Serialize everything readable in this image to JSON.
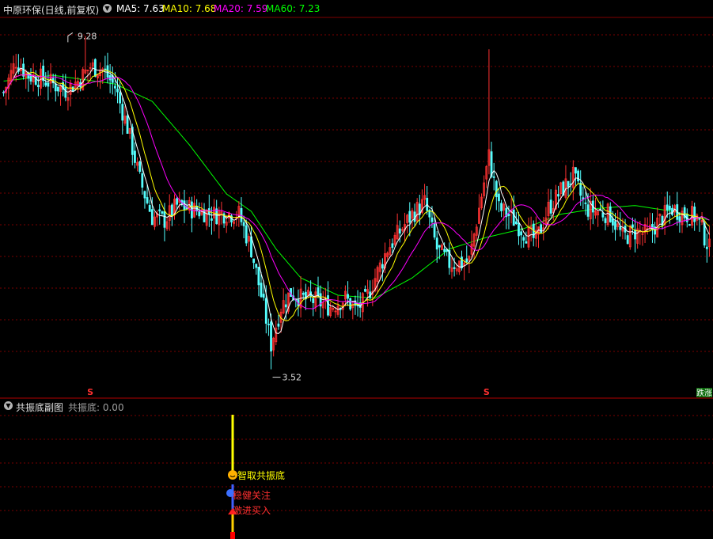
{
  "header": {
    "stock_title": "中原环保(日线,前复权)",
    "ma5_label": "MA5: 7.63",
    "ma10_label": "MA10: 7.68",
    "ma20_label": "MA20: 7.59",
    "ma60_label": "MA60: 7.23",
    "ma5_color": "#ffffff",
    "ma10_color": "#ffff00",
    "ma20_color": "#ff00ff",
    "ma60_color": "#00ff00",
    "collapse_icon": "chevron-down-icon"
  },
  "subpanel": {
    "title": "共振底副图",
    "value_label": "共振底: 0.00",
    "signals": [
      "智取共振底",
      "稳健关注",
      "激进买入"
    ],
    "signal_icons": [
      "smile-icon",
      "info-icon",
      "buy-arrow-icon"
    ]
  },
  "annotations": {
    "high_label": "9.28",
    "low_label": "3.52",
    "s_marker": "S",
    "corner_badge": "跌涨"
  },
  "chart_data": {
    "type": "candlestick",
    "title": "中原环保(日线,前复权)",
    "y_high": 9.28,
    "y_low": 3.52,
    "ylim": [
      3.2,
      9.6
    ],
    "grid": true,
    "colors": {
      "up": "#ff3232",
      "down": "#54ffff",
      "flat": "#ffffff"
    },
    "price_path": [
      [
        0,
        8.3
      ],
      [
        5,
        8.85
      ],
      [
        10,
        8.6
      ],
      [
        15,
        8.55
      ],
      [
        20,
        8.45
      ],
      [
        25,
        8.35
      ],
      [
        30,
        8.5
      ],
      [
        35,
        8.75
      ],
      [
        40,
        8.7
      ],
      [
        45,
        8.4
      ],
      [
        50,
        7.7
      ],
      [
        55,
        6.8
      ],
      [
        60,
        6.15
      ],
      [
        65,
        6.1
      ],
      [
        70,
        6.35
      ],
      [
        75,
        6.3
      ],
      [
        80,
        6.25
      ],
      [
        85,
        6.2
      ],
      [
        90,
        6.22
      ],
      [
        95,
        6.2
      ],
      [
        100,
        5.6
      ],
      [
        105,
        4.6
      ],
      [
        108,
        3.95
      ],
      [
        112,
        4.6
      ],
      [
        116,
        4.85
      ],
      [
        120,
        4.75
      ],
      [
        126,
        4.7
      ],
      [
        132,
        4.6
      ],
      [
        138,
        4.75
      ],
      [
        142,
        4.55
      ],
      [
        146,
        4.7
      ],
      [
        150,
        5.1
      ],
      [
        155,
        5.6
      ],
      [
        160,
        5.9
      ],
      [
        165,
        6.2
      ],
      [
        170,
        6.4
      ],
      [
        175,
        5.6
      ],
      [
        180,
        5.35
      ],
      [
        185,
        5.35
      ],
      [
        188,
        5.4
      ],
      [
        192,
        6.3
      ],
      [
        196,
        7.2
      ],
      [
        200,
        6.3
      ],
      [
        205,
        6.15
      ],
      [
        210,
        5.9
      ],
      [
        215,
        5.75
      ],
      [
        220,
        6.3
      ],
      [
        225,
        6.6
      ],
      [
        230,
        6.85
      ],
      [
        235,
        6.3
      ],
      [
        240,
        6.25
      ],
      [
        245,
        6.2
      ],
      [
        250,
        5.8
      ],
      [
        255,
        5.9
      ],
      [
        260,
        5.85
      ],
      [
        265,
        6.1
      ],
      [
        270,
        6.3
      ],
      [
        275,
        6.2
      ],
      [
        280,
        6.15
      ],
      [
        285,
        5.6
      ]
    ],
    "ma60_path": [
      [
        0,
        8.5
      ],
      [
        20,
        8.6
      ],
      [
        45,
        8.45
      ],
      [
        60,
        8.15
      ],
      [
        75,
        7.4
      ],
      [
        90,
        6.55
      ],
      [
        100,
        6.25
      ],
      [
        110,
        5.6
      ],
      [
        120,
        5.1
      ],
      [
        135,
        4.8
      ],
      [
        150,
        4.75
      ],
      [
        165,
        5.1
      ],
      [
        180,
        5.6
      ],
      [
        195,
        5.8
      ],
      [
        210,
        5.95
      ],
      [
        225,
        6.2
      ],
      [
        240,
        6.3
      ],
      [
        255,
        6.35
      ],
      [
        270,
        6.25
      ],
      [
        285,
        6.1
      ]
    ],
    "s_markers_x": [
      35,
      195
    ],
    "x_count": 286
  }
}
